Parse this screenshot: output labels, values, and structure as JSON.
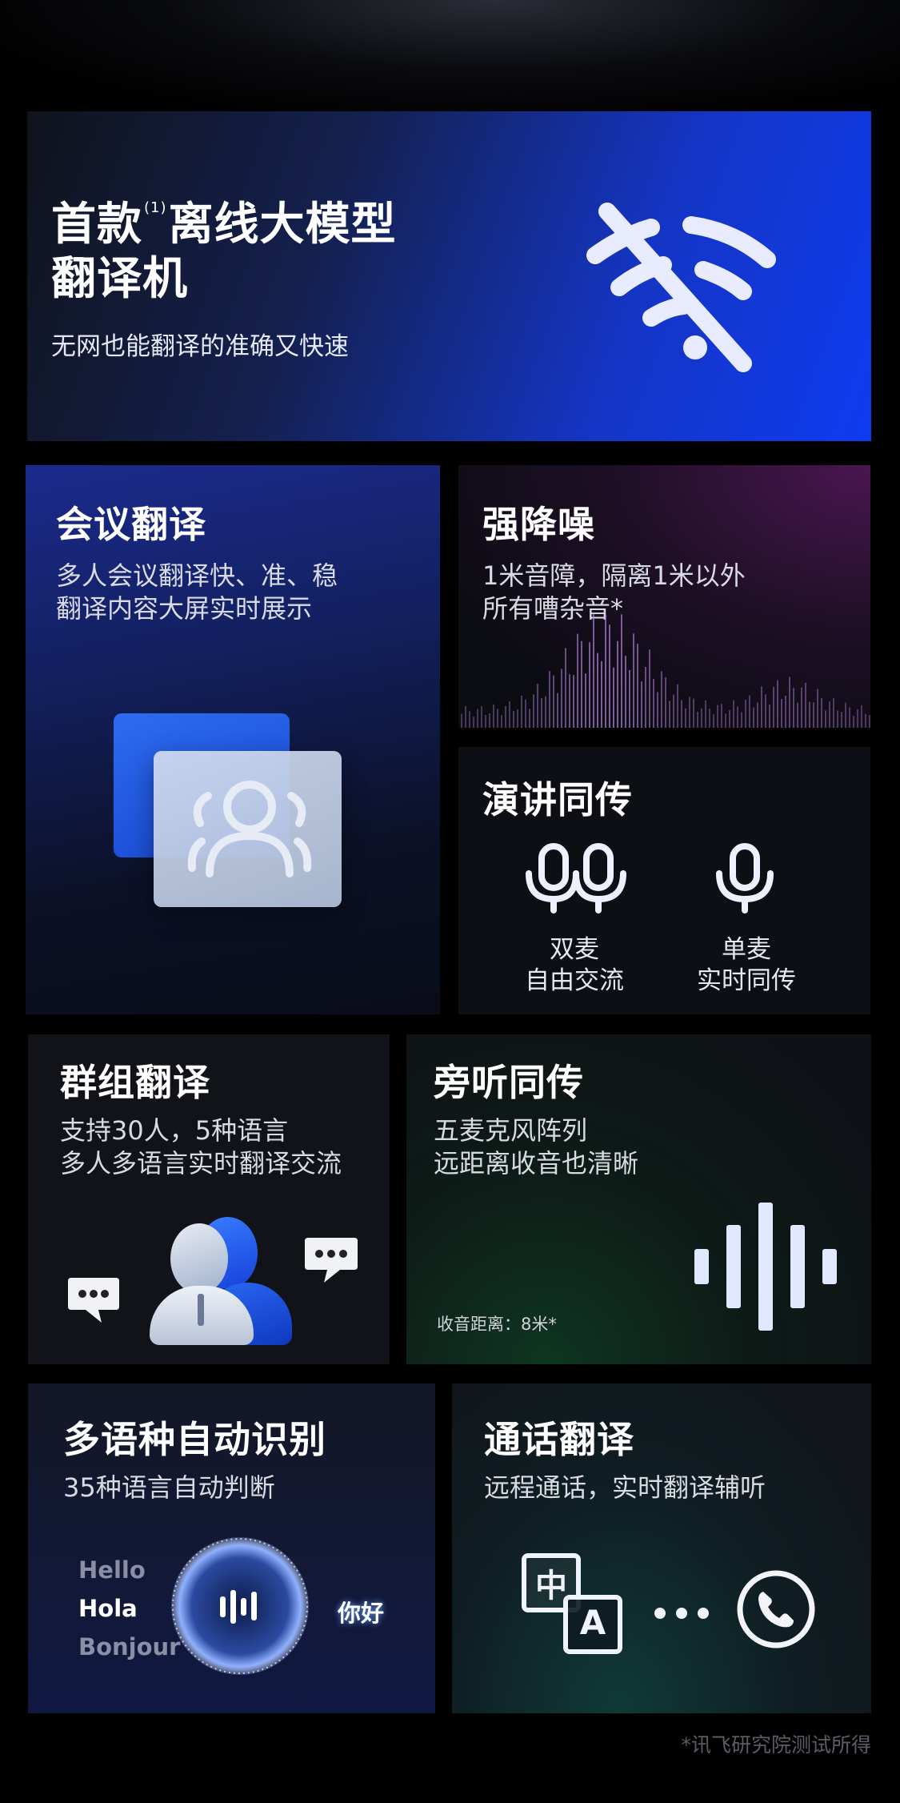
{
  "hero": {
    "title_pre": "首款",
    "title_sup": "(1)",
    "title_post": "离线大模型",
    "title_line2": "翻译机",
    "subtitle": "无网也能翻译的准确又快速",
    "icon": "wifi-off-icon"
  },
  "meeting": {
    "title": "会议翻译",
    "lines": [
      "多人会议翻译快、准、稳",
      "翻译内容大屏实时展示"
    ],
    "icon": "group-users-icon"
  },
  "noise": {
    "title": "强降噪",
    "lines": [
      "1米音障，隔离1米以外",
      "所有嘈杂音*"
    ],
    "icon": "sound-wave-icon"
  },
  "speech": {
    "title": "演讲同传",
    "dual": {
      "line1": "双麦",
      "line2": "自由交流",
      "icon": "dual-mic-icon"
    },
    "single": {
      "line1": "单麦",
      "line2": "实时同传",
      "icon": "mic-icon"
    }
  },
  "group": {
    "title": "群组翻译",
    "lines": [
      "支持30人，5种语言",
      "多人多语言实时翻译交流"
    ],
    "icons": [
      "chat-bubble-icon",
      "person-icon",
      "chat-bubble-icon"
    ]
  },
  "listen": {
    "title": "旁听同传",
    "lines": [
      "五麦克风阵列",
      "远距离收音也清晰"
    ],
    "note": "收音距离：8米*",
    "icon": "audio-bars-icon"
  },
  "lang": {
    "title": "多语种自动识别",
    "lines": [
      "35种语言自动判断"
    ],
    "words": [
      "Hello",
      "Hola",
      "Bonjour",
      "你好"
    ],
    "icon": "voice-orb-icon"
  },
  "call": {
    "title": "通话翻译",
    "lines": [
      "远程通话，实时翻译辅听"
    ],
    "translate_glyph_1": "中",
    "translate_glyph_2": "A",
    "icons": [
      "translate-icon",
      "dots-icon",
      "phone-icon"
    ]
  },
  "footnote": "*讯飞研究院测试所得",
  "colors": {
    "accent_blue": "#0f3bf0",
    "text": "#ffffff",
    "muted": "#5b5d66"
  }
}
